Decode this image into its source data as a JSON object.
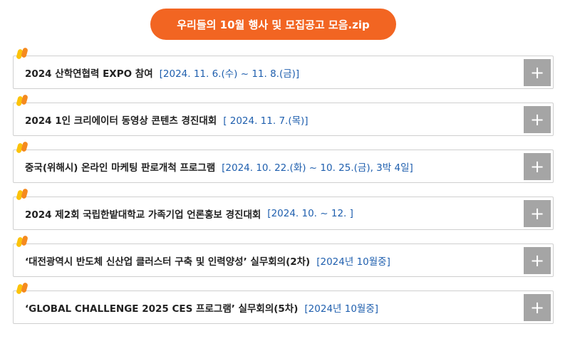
{
  "header": {
    "title": "우리들의 10월 행사 및 모집공고 모음.zip"
  },
  "colors": {
    "accent": "#f26522",
    "date_text": "#1f5fae",
    "button_bg": "#a5a5a5",
    "marker_orange": "#f58a1f",
    "marker_yellow": "#fcc30b"
  },
  "items": [
    {
      "title": "2024 산학연협력 EXPO 참여",
      "date": "[2024. 11. 6.(수) ~ 11. 8.(금)]",
      "button_icon": "plus-icon",
      "button_label": "+"
    },
    {
      "title": "2024 1인 크리에이터 동영상 콘텐츠 경진대회",
      "date": "[ 2024. 11. 7.(목)]",
      "button_icon": "plus-icon",
      "button_label": "+"
    },
    {
      "title": "중국(위해시) 온라인 마케팅 판로개척 프로그램",
      "date": "[2024. 10. 22.(화) ~ 10. 25.(금), 3박 4일]",
      "button_icon": "plus-icon",
      "button_label": "+"
    },
    {
      "title": "2024 제2회 국립한밭대학교 가족기업 언론홍보 경진대회",
      "date": "[2024. 10. ~ 12. ]",
      "button_icon": "plus-icon",
      "button_label": "+"
    },
    {
      "title": "‘대전광역시 반도체 신산업 클러스터 구축 및 인력양성’ 실무회의(2차)",
      "date": "[2024년 10월중]",
      "button_icon": "plus-icon",
      "button_label": "+"
    },
    {
      "title": "‘GLOBAL CHALLENGE 2025 CES 프로그램’ 실무회의(5차)",
      "date": "[2024년 10월중]",
      "button_icon": "plus-icon",
      "button_label": "+"
    }
  ]
}
